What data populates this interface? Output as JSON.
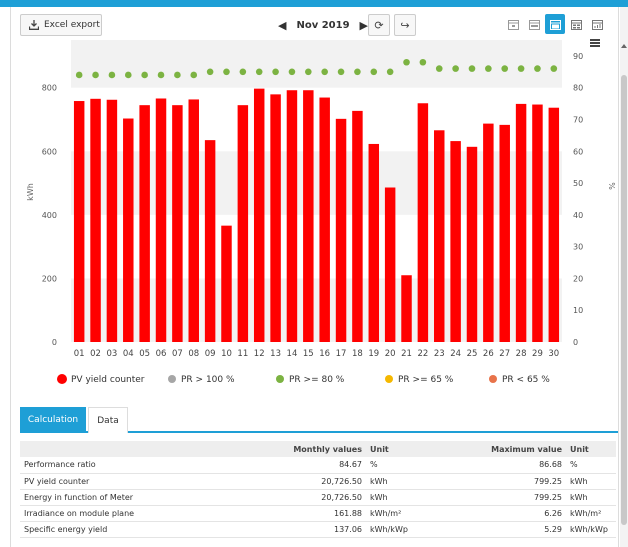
{
  "toolbar": {
    "export_label": "Excel export",
    "period_label": "Nov 2019",
    "prev_icon": "chevron-left-icon",
    "next_icon": "chevron-right-icon",
    "refresh_icon": "refresh-icon",
    "share_icon": "share-icon",
    "view_buttons": [
      "day-view-icon",
      "week-view-icon",
      "month-view-icon",
      "year-view-icon",
      "total-view-icon"
    ],
    "active_view": "month-view-icon",
    "accent": "#1e9fd6"
  },
  "chart_data": {
    "type": "bar",
    "categories": [
      "01",
      "02",
      "03",
      "04",
      "05",
      "06",
      "07",
      "08",
      "09",
      "10",
      "11",
      "12",
      "13",
      "14",
      "15",
      "16",
      "17",
      "18",
      "19",
      "20",
      "21",
      "22",
      "23",
      "24",
      "25",
      "26",
      "27",
      "28",
      "29",
      "30"
    ],
    "series": [
      {
        "name": "PV yield counter",
        "type": "bar",
        "axis": "left",
        "color": "#ff0000",
        "values": [
          758,
          765,
          762,
          703,
          745,
          766,
          745,
          763,
          635,
          366,
          745,
          797,
          779,
          792,
          792,
          769,
          702,
          727,
          623,
          486,
          210,
          751,
          666,
          632,
          614,
          687,
          683,
          749,
          747,
          737
        ]
      },
      {
        "name": "PR",
        "type": "scatter",
        "axis": "right",
        "color": "#7cb342",
        "values": [
          84,
          84,
          84,
          84,
          84,
          84,
          84,
          84,
          85,
          85,
          85,
          85,
          85,
          85,
          85,
          85,
          85,
          85,
          85,
          85,
          88,
          88,
          86,
          86,
          86,
          86,
          86,
          86,
          86,
          86
        ]
      }
    ],
    "ylabel": "kWh",
    "y2label": "%",
    "ylim": [
      0,
      950
    ],
    "yticks": [
      0,
      200,
      400,
      600,
      800
    ],
    "y2lim": [
      0,
      95
    ],
    "y2ticks": [
      0,
      10,
      20,
      30,
      40,
      50,
      60,
      70,
      80,
      90
    ],
    "grid": "horizontal bands",
    "legend_position": "bottom",
    "legend": [
      {
        "label": "PV yield counter",
        "color": "#ff0000"
      },
      {
        "label": "PR > 100 %",
        "color": "#a6a6a6"
      },
      {
        "label": "PR >= 80 %",
        "color": "#7cb342"
      },
      {
        "label": "PR >= 65 %",
        "color": "#f5b800"
      },
      {
        "label": "PR < 65 %",
        "color": "#e8734a"
      }
    ]
  },
  "tabs": [
    "Calculation",
    "Data"
  ],
  "table": {
    "headers": [
      "",
      "Monthly values",
      "Unit",
      "Maximum value",
      "Unit"
    ],
    "rows": [
      [
        "Performance ratio",
        "84.67",
        "%",
        "86.68",
        "%"
      ],
      [
        "PV yield counter",
        "20,726.50",
        "kWh",
        "799.25",
        "kWh"
      ],
      [
        "Energy in function of Meter",
        "20,726.50",
        "kWh",
        "799.25",
        "kWh"
      ],
      [
        "Irradiance on module plane",
        "161.88",
        "kWh/m²",
        "6.26",
        "kWh/m²"
      ],
      [
        "Specific energy yield",
        "137.06",
        "kWh/kWp",
        "5.29",
        "kWh/kWp"
      ]
    ]
  }
}
